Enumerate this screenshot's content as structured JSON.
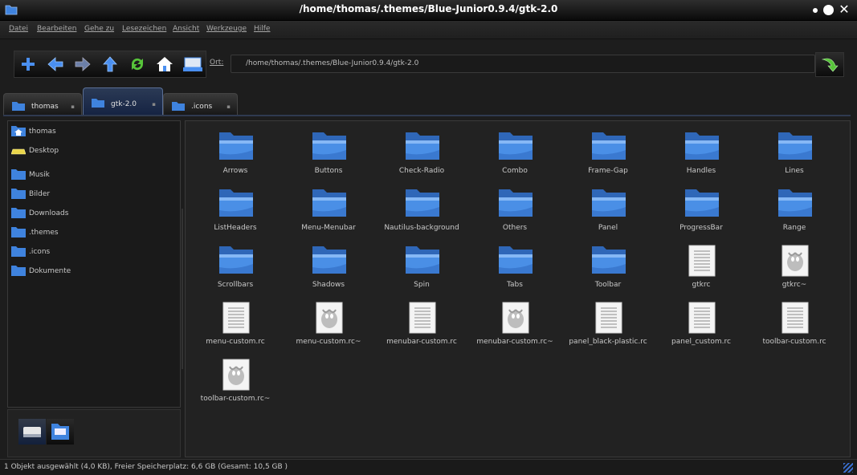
{
  "window": {
    "title": "/home/thomas/.themes/Blue-Junior0.9.4/gtk-2.0"
  },
  "menu": [
    "Datei",
    "Bearbeiten",
    "Gehe zu",
    "Lesezeichen",
    "Ansicht",
    "Werkzeuge",
    "Hilfe"
  ],
  "toolbar": {
    "buttons": [
      "new-tab-icon",
      "back-icon",
      "forward-icon",
      "up-icon",
      "reload-icon",
      "home-icon",
      "computer-icon"
    ],
    "location_label": "Ort:",
    "location_value": "/home/thomas/.themes/Blue-Junior0.9.4/gtk-2.0",
    "go_icon": "go-arrow-icon"
  },
  "tabs": [
    {
      "label": "thomas",
      "close": "x"
    },
    {
      "label": "gtk-2.0",
      "close": "x"
    },
    {
      "label": ".icons",
      "close": "x"
    }
  ],
  "sidebar": [
    {
      "label": "thomas",
      "icon": "home-folder-icon"
    },
    {
      "label": "Desktop",
      "icon": "desktop-icon"
    },
    {
      "label": "Musik",
      "icon": "folder-icon"
    },
    {
      "label": "Bilder",
      "icon": "folder-icon"
    },
    {
      "label": "Downloads",
      "icon": "folder-icon"
    },
    {
      "label": ".themes",
      "icon": "folder-icon"
    },
    {
      "label": ".icons",
      "icon": "folder-icon"
    },
    {
      "label": "Dokumente",
      "icon": "folder-icon"
    }
  ],
  "files": [
    {
      "name": "Arrows",
      "type": "folder"
    },
    {
      "name": "Buttons",
      "type": "folder"
    },
    {
      "name": "Check-Radio",
      "type": "folder"
    },
    {
      "name": "Combo",
      "type": "folder"
    },
    {
      "name": "Frame-Gap",
      "type": "folder"
    },
    {
      "name": "Handles",
      "type": "folder"
    },
    {
      "name": "Lines",
      "type": "folder"
    },
    {
      "name": "ListHeaders",
      "type": "folder"
    },
    {
      "name": "Menu-Menubar",
      "type": "folder"
    },
    {
      "name": "Nautilus-background",
      "type": "folder"
    },
    {
      "name": "Others",
      "type": "folder"
    },
    {
      "name": "Panel",
      "type": "folder"
    },
    {
      "name": "ProgressBar",
      "type": "folder"
    },
    {
      "name": "Range",
      "type": "folder"
    },
    {
      "name": "Scrollbars",
      "type": "folder"
    },
    {
      "name": "Shadows",
      "type": "folder"
    },
    {
      "name": "Spin",
      "type": "folder"
    },
    {
      "name": "Tabs",
      "type": "folder"
    },
    {
      "name": "Toolbar",
      "type": "folder"
    },
    {
      "name": "gtkrc",
      "type": "text"
    },
    {
      "name": "gtkrc~",
      "type": "backup"
    },
    {
      "name": "menu-custom.rc",
      "type": "text"
    },
    {
      "name": "menu-custom.rc~",
      "type": "backup"
    },
    {
      "name": "menubar-custom.rc",
      "type": "text"
    },
    {
      "name": "menubar-custom.rc~",
      "type": "backup"
    },
    {
      "name": "panel_black-plastic.rc",
      "type": "text"
    },
    {
      "name": "panel_custom.rc",
      "type": "text"
    },
    {
      "name": "toolbar-custom.rc",
      "type": "text"
    },
    {
      "name": "toolbar-custom.rc~",
      "type": "backup"
    }
  ],
  "status": {
    "text": "1 Objekt ausgewählt (4,0 KB), Freier Speicherplatz: 6,6 GB (Gesamt: 10,5 GB )"
  },
  "colors": {
    "folder_blue": "#3f83de",
    "accent": "#2b4c8f"
  }
}
